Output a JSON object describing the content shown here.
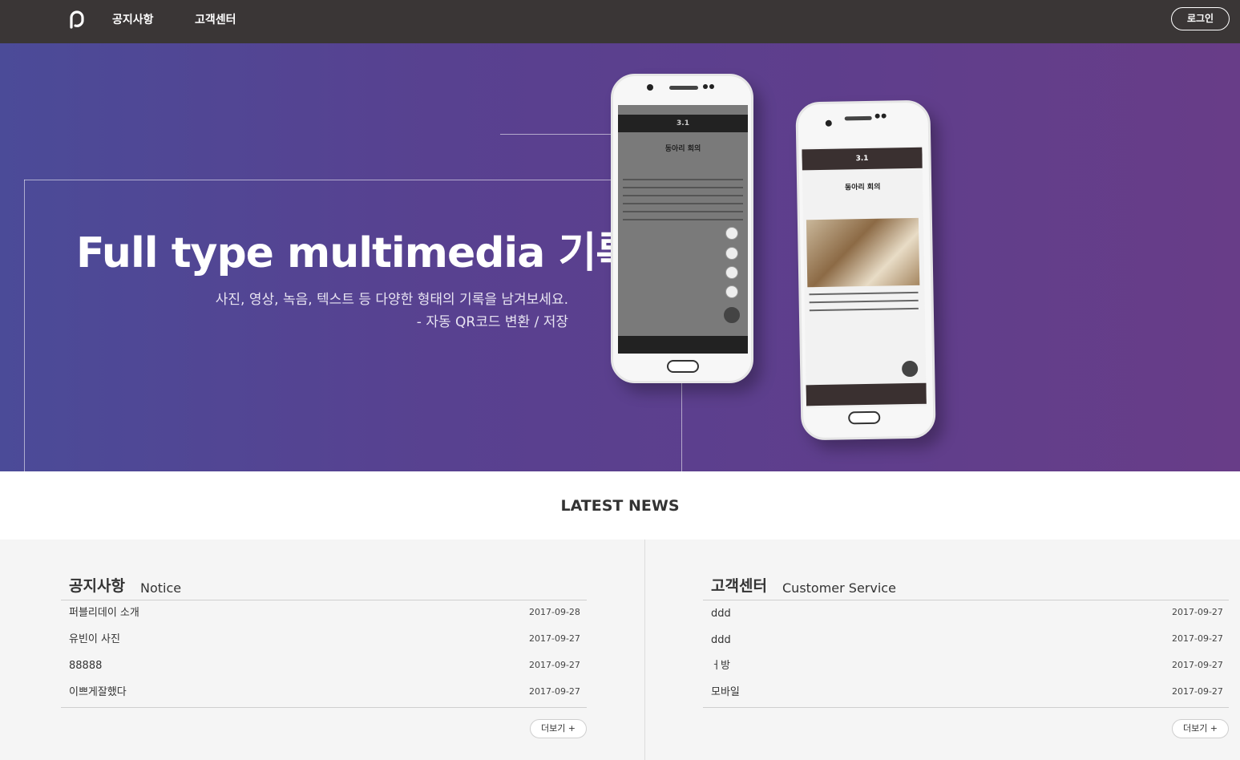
{
  "nav": {
    "links": [
      "공지사항",
      "고객센터"
    ],
    "login_label": "로그인"
  },
  "hero": {
    "title": "Full type multimedia 기록",
    "subtitle_line1": "사진, 영상, 녹음, 텍스트 등 다양한 형태의 기록을 남겨보세요.",
    "subtitle_line2": "- 자동 QR코드 변환 / 저장",
    "phone_left": {
      "date": "3.1",
      "heading": "동아리 회의"
    },
    "phone_right": {
      "date": "3.1",
      "heading": "동아리 회의"
    }
  },
  "news": {
    "title": "LATEST NEWS",
    "notice": {
      "title": "공지사항",
      "subtitle": "Notice",
      "rows": [
        {
          "title": "퍼블리데이 소개",
          "date": "2017-09-28"
        },
        {
          "title": "유빈이 사진",
          "date": "2017-09-27"
        },
        {
          "title": "88888",
          "date": "2017-09-27"
        },
        {
          "title": "이쁘게잘했다",
          "date": "2017-09-27"
        }
      ],
      "more_label": "더보기 +"
    },
    "support": {
      "title": "고객센터",
      "subtitle": "Customer Service",
      "rows": [
        {
          "title": "ddd",
          "date": "2017-09-27"
        },
        {
          "title": "ddd",
          "date": "2017-09-27"
        },
        {
          "title": "ㅓ방",
          "date": "2017-09-27"
        },
        {
          "title": "모바일",
          "date": "2017-09-27"
        }
      ],
      "more_label": "더보기 +"
    }
  }
}
